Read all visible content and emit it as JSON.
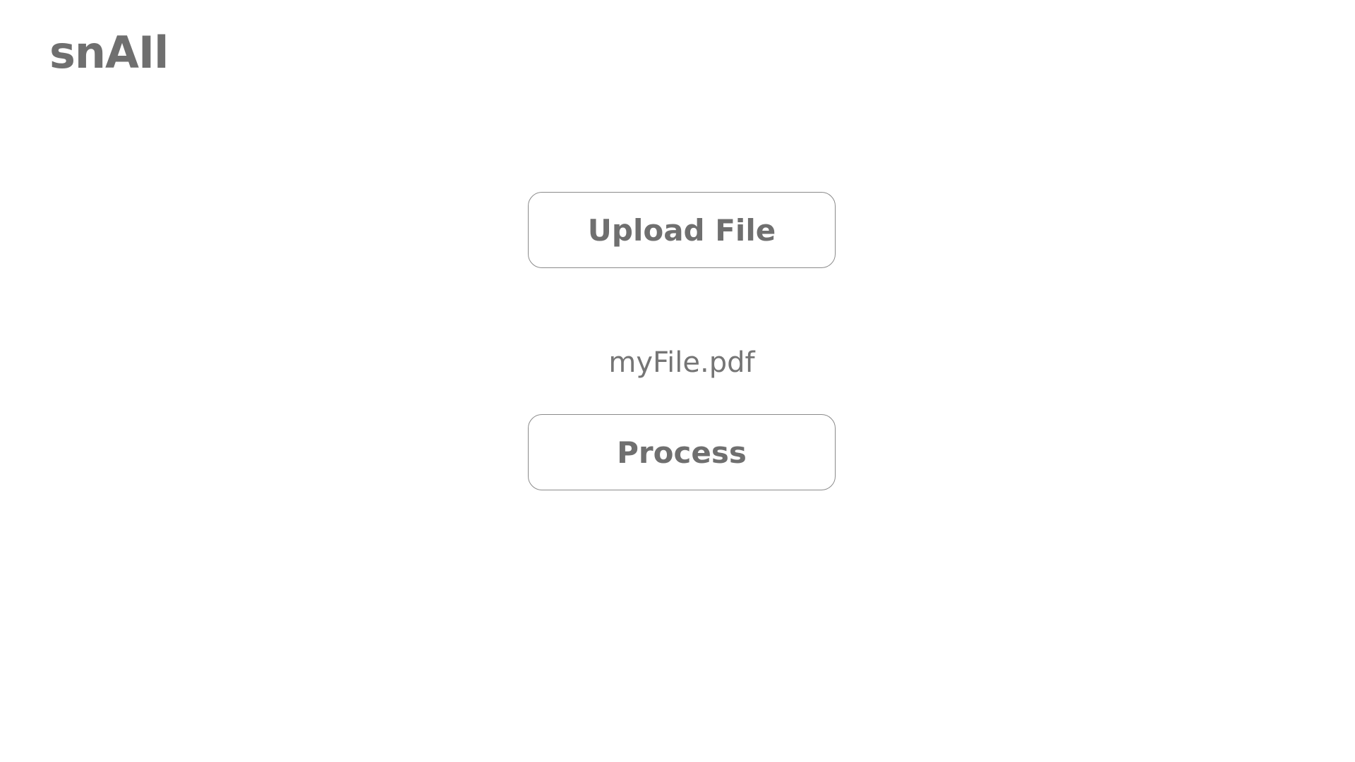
{
  "app": {
    "title": "snAIl"
  },
  "main": {
    "upload_button_label": "Upload File",
    "selected_file_name": "myFile.pdf",
    "process_button_label": "Process"
  },
  "colors": {
    "text": "#6f6f6f",
    "button_border": "#8a8a8a",
    "background": "#ffffff"
  }
}
